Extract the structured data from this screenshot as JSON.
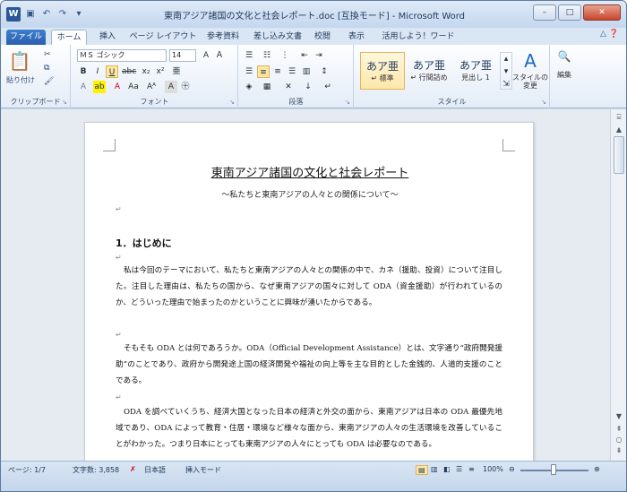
{
  "titlebar": {
    "title": "東南アジア諸国の文化と社会レポート.doc [互換モード] - Microsoft Word",
    "app_icon": "W",
    "qat": [
      "save-icon",
      "undo-icon",
      "redo-icon",
      "customize-icon"
    ]
  },
  "tabs": [
    "ファイル",
    "ホーム",
    "挿入",
    "ページ レイアウト",
    "参考資料",
    "差し込み文書",
    "校閲",
    "表示",
    "活用しよう！ワード"
  ],
  "ribbon": {
    "clipboard": {
      "paste": "貼り付け",
      "label": "クリップボード"
    },
    "font": {
      "name": "ＭＳ ゴシック",
      "size": "14",
      "label": "フォント"
    },
    "paragraph": {
      "label": "段落"
    },
    "styles": {
      "items": [
        {
          "preview": "あア亜",
          "name": "↵ 標準"
        },
        {
          "preview": "あア亜",
          "name": "↵ 行間詰め"
        },
        {
          "preview": "あア亜",
          "name": "見出し 1"
        }
      ],
      "change": "スタイルの変更",
      "label": "スタイル"
    },
    "editing": {
      "label": "編集"
    }
  },
  "document": {
    "title": "東南アジア諸国の文化と社会レポート",
    "subtitle": "～私たちと東南アジアの人々との関係について～",
    "heading": "1．はじめに",
    "paragraphs": [
      "私は今回のテーマにおいて、私たちと東南アジアの人々との関係の中で、カネ（援助、投資）について注目した。注目した理由は、私たちの国から、なぜ東南アジアの国々に対して ODA（資金援助）が行われているのか、どういった理由で始まったのかということに興味が湧いたからである。",
      "そもそも ODA とは何であろうか。ODA（Official Development Assistance）とは、文字通り“政府開発援助”のことであり、政府から開発途上国の経済開発や福祉の向上等を主な目的とした金銭的、人道的支援のことである。",
      "ODA を調べていくうち、経済大国となった日本の経済と外交の面から、東南アジアは日本の ODA 最優先地域であり、ODA によって教育・住居・環境など様々な面から、東南アジアの人々の生活環境を改善していることがわかった。つまり日本にとっても東南アジアの人々にとっても ODA は必要なのである。"
    ]
  },
  "status": {
    "page": "ページ: 1/7",
    "words": "文字数: 3,858",
    "lang": "日本語",
    "mode": "挿入モード",
    "zoom": "100%"
  }
}
